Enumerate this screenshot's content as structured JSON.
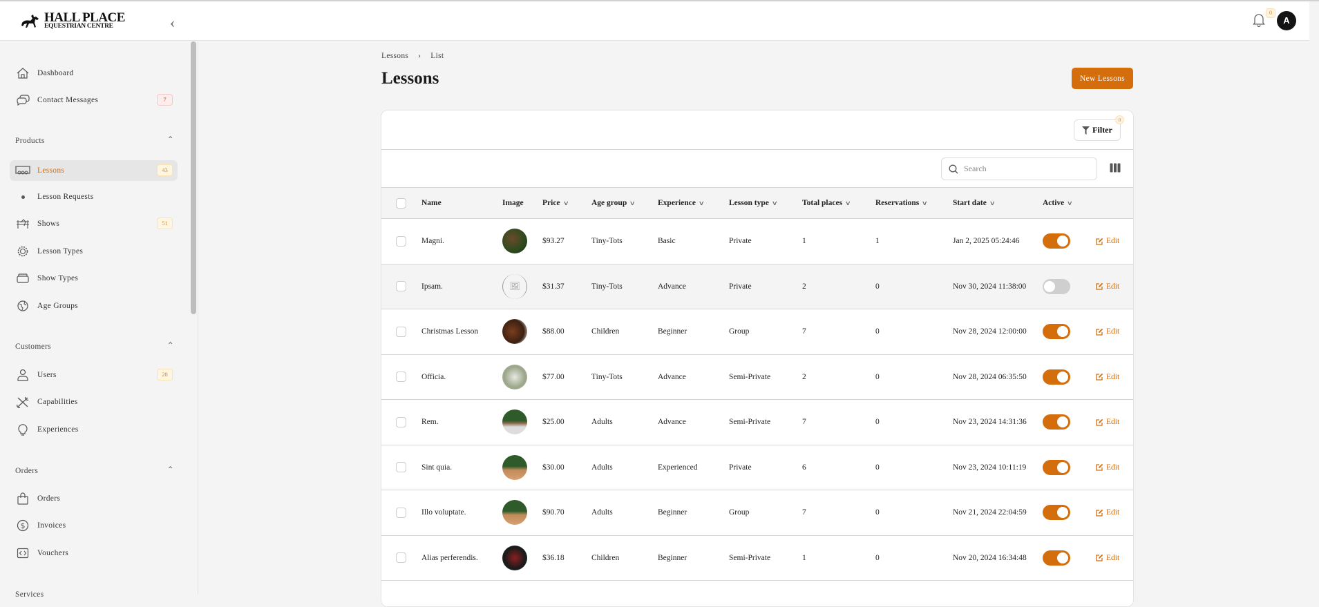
{
  "brand": {
    "line1": "HALL PLACE",
    "line2": "EQUESTRIAN CENTRE"
  },
  "header": {
    "notification_count": "0",
    "avatar_initial": "A"
  },
  "sidebar": {
    "top": [
      {
        "label": "Dashboard",
        "icon": "home-icon"
      },
      {
        "label": "Contact Messages",
        "icon": "chat-icon",
        "badge": "7"
      }
    ],
    "sections": [
      {
        "label": "Products",
        "items": [
          {
            "label": "Lessons",
            "badge": "43",
            "active": true
          },
          {
            "label": "Lesson Requests"
          },
          {
            "label": "Shows",
            "badge": "51"
          },
          {
            "label": "Lesson Types"
          },
          {
            "label": "Show Types"
          },
          {
            "label": "Age Groups"
          }
        ]
      },
      {
        "label": "Customers",
        "items": [
          {
            "label": "Users",
            "badge": "28"
          },
          {
            "label": "Capabilities"
          },
          {
            "label": "Experiences"
          }
        ]
      },
      {
        "label": "Orders",
        "items": [
          {
            "label": "Orders"
          },
          {
            "label": "Invoices"
          },
          {
            "label": "Vouchers"
          }
        ]
      },
      {
        "label": "Services"
      }
    ]
  },
  "breadcrumb": [
    "Lessons",
    "List"
  ],
  "page": {
    "title": "Lessons",
    "new_button": "New Lessons"
  },
  "table": {
    "filter_label": "Filter",
    "filter_count": "0",
    "search_placeholder": "Search",
    "columns": [
      "Name",
      "Image",
      "Price",
      "Age group",
      "Experience",
      "Lesson type",
      "Total places",
      "Reservations",
      "Start date",
      "Active"
    ],
    "edit_label": "Edit",
    "rows": [
      {
        "name": "Magni.",
        "price": "$93.27",
        "age": "Tiny-Tots",
        "exp": "Basic",
        "type": "Private",
        "places": "1",
        "res": "1",
        "start": "Jan 2, 2025 05:24:46",
        "active": true
      },
      {
        "name": "Ipsam.",
        "price": "$31.37",
        "age": "Tiny-Tots",
        "exp": "Advance",
        "type": "Private",
        "places": "2",
        "res": "0",
        "start": "Nov 30, 2024 11:38:00",
        "active": false
      },
      {
        "name": "Christmas Lesson",
        "price": "$88.00",
        "age": "Children",
        "exp": "Beginner",
        "type": "Group",
        "places": "7",
        "res": "0",
        "start": "Nov 28, 2024 12:00:00",
        "active": true
      },
      {
        "name": "Officia.",
        "price": "$77.00",
        "age": "Tiny-Tots",
        "exp": "Advance",
        "type": "Semi-Private",
        "places": "2",
        "res": "0",
        "start": "Nov 28, 2024 06:35:50",
        "active": true
      },
      {
        "name": "Rem.",
        "price": "$25.00",
        "age": "Adults",
        "exp": "Advance",
        "type": "Semi-Private",
        "places": "7",
        "res": "0",
        "start": "Nov 23, 2024 14:31:36",
        "active": true
      },
      {
        "name": "Sint quia.",
        "price": "$30.00",
        "age": "Adults",
        "exp": "Experienced",
        "type": "Private",
        "places": "6",
        "res": "0",
        "start": "Nov 23, 2024 10:11:19",
        "active": true
      },
      {
        "name": "Illo voluptate.",
        "price": "$90.70",
        "age": "Adults",
        "exp": "Beginner",
        "type": "Group",
        "places": "7",
        "res": "0",
        "start": "Nov 21, 2024 22:04:59",
        "active": true
      },
      {
        "name": "Alias perferendis.",
        "price": "$36.18",
        "age": "Children",
        "exp": "Beginner",
        "type": "Semi-Private",
        "places": "1",
        "res": "0",
        "start": "Nov 20, 2024 16:34:48",
        "active": true
      }
    ]
  },
  "colors": {
    "accent": "#d46d0b",
    "background": "#f4f4f4"
  }
}
